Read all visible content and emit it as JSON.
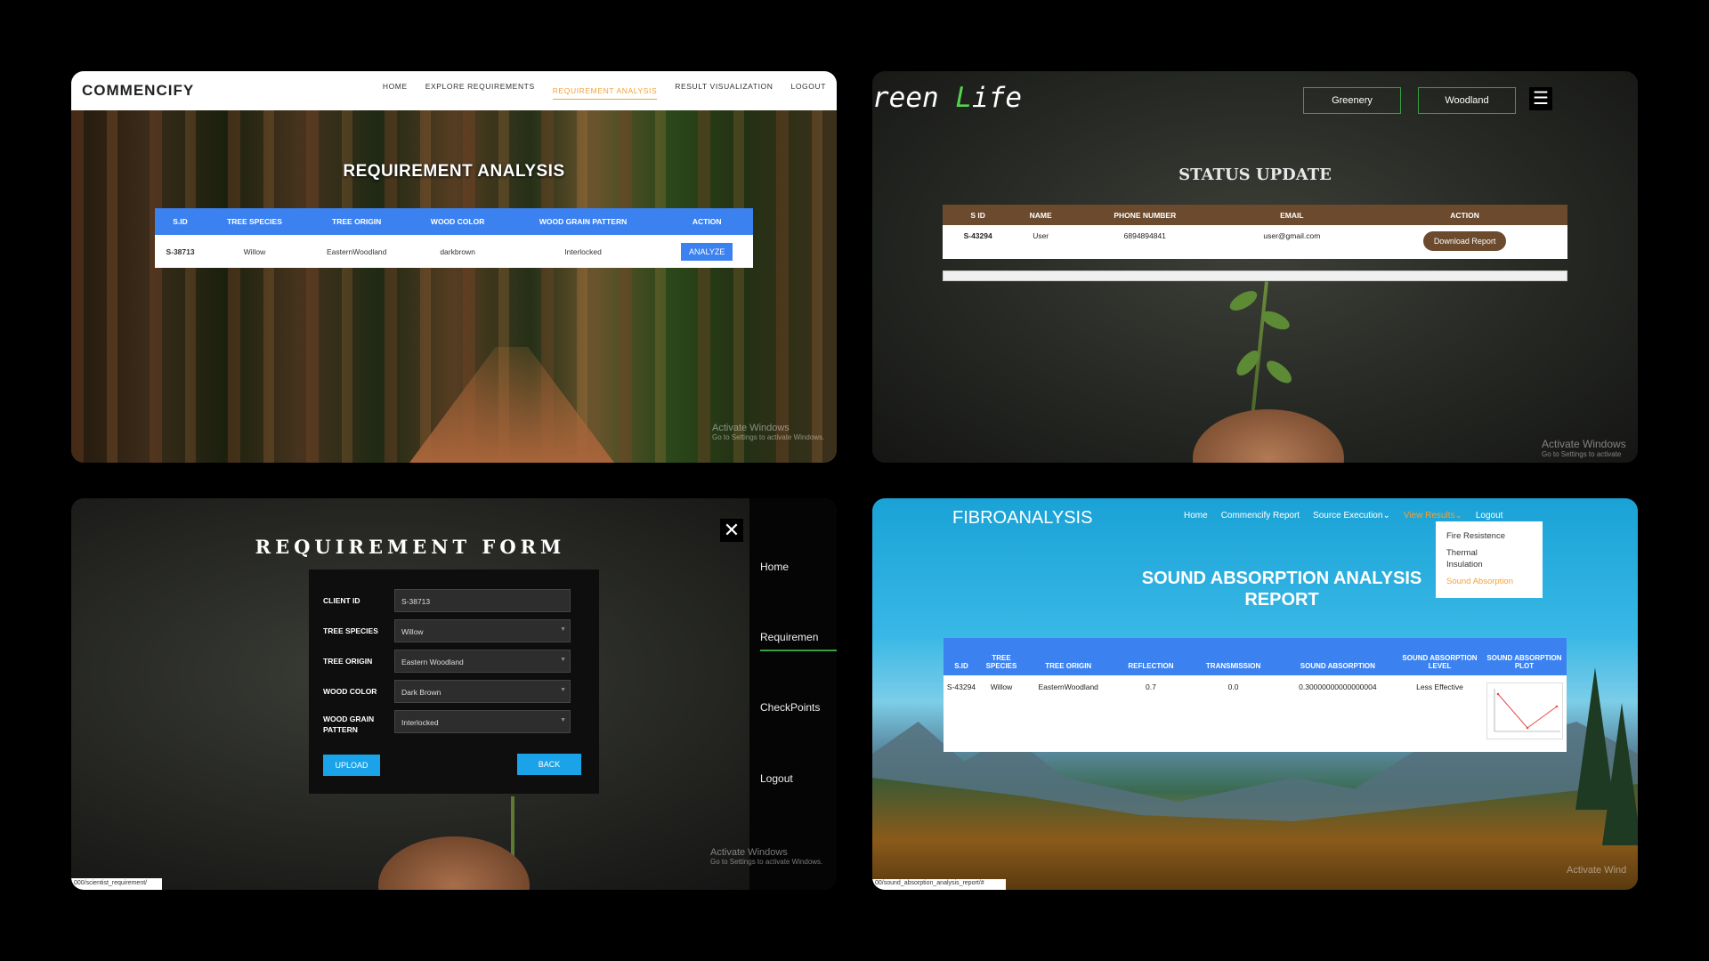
{
  "panel1": {
    "brand": "COMMENCIFY",
    "nav": [
      "HOME",
      "EXPLORE REQUIREMENTS",
      "REQUIREMENT ANALYSIS",
      "RESULT VISUALIZATION",
      "LOGOUT"
    ],
    "active_nav": "REQUIREMENT ANALYSIS",
    "title": "REQUIREMENT ANALYSIS",
    "columns": [
      "S.ID",
      "TREE SPECIES",
      "TREE ORIGIN",
      "WOOD COLOR",
      "WOOD GRAIN PATTERN",
      "ACTION"
    ],
    "row": {
      "sid": "S-38713",
      "species": "Willow",
      "origin": "EasternWoodland",
      "color": "darkbrown",
      "grain": "Interlocked",
      "action": "ANALYZE"
    },
    "watermark": "Activate Windows",
    "watermark_sub": "Go to Settings to activate Windows."
  },
  "panel2": {
    "logo_prefix": "reen ",
    "logo_l": "L",
    "logo_suffix": "ife",
    "nav": [
      "Greenery",
      "Woodland"
    ],
    "title": "STATUS UPDATE",
    "columns": [
      "S ID",
      "NAME",
      "PHONE NUMBER",
      "EMAIL",
      "ACTION"
    ],
    "row": {
      "sid": "S-43294",
      "name": "User",
      "phone": "6894894841",
      "email": "user@gmail.com",
      "action": "Download Report"
    },
    "watermark": "Activate Windows",
    "watermark_sub": "Go to Settings to activate"
  },
  "panel3": {
    "title": "REQUIREMENT FORM",
    "fields": [
      {
        "label": "CLIENT ID",
        "value": "S-38713"
      },
      {
        "label": "TREE SPECIES",
        "value": "Willow"
      },
      {
        "label": "TREE ORIGIN",
        "value": "Eastern Woodland"
      },
      {
        "label": "WOOD COLOR",
        "value": "Dark Brown"
      },
      {
        "label": "WOOD GRAIN PATTERN",
        "value": "Interlocked"
      }
    ],
    "upload": "UPLOAD",
    "back": "BACK",
    "sidebar": [
      "Home",
      "Requiremen",
      "CheckPoints",
      "Logout"
    ],
    "watermark": "Activate Windows",
    "watermark_sub": "Go to Settings to activate Windows.",
    "url": "000/scientist_requirement/"
  },
  "panel4": {
    "brand": "FIBROANALYSIS",
    "nav": [
      "Home",
      "Commencify Report",
      "Source Execution",
      "View Results",
      "Logout"
    ],
    "dropdown": [
      "Fire Resistence",
      "Thermal Insulation",
      "Sound Absorption"
    ],
    "title": "SOUND ABSORPTION ANALYSIS REPORT",
    "columns": [
      "S.ID",
      "TREE SPECIES",
      "TREE ORIGIN",
      "REFLECTION",
      "TRANSMISSION",
      "SOUND ABSORPTION",
      "SOUND ABSORPTION LEVEL",
      "SOUND ABSORPTION PLOT"
    ],
    "row": {
      "sid": "S-43294",
      "species": "Willow",
      "origin": "EasternWoodland",
      "reflection": "0.7",
      "transmission": "0.0",
      "absorption": "0.30000000000000004",
      "level": "Less Effective"
    },
    "watermark": "Activate Wind",
    "url": "00/sound_absorption_analysis_report/#"
  }
}
